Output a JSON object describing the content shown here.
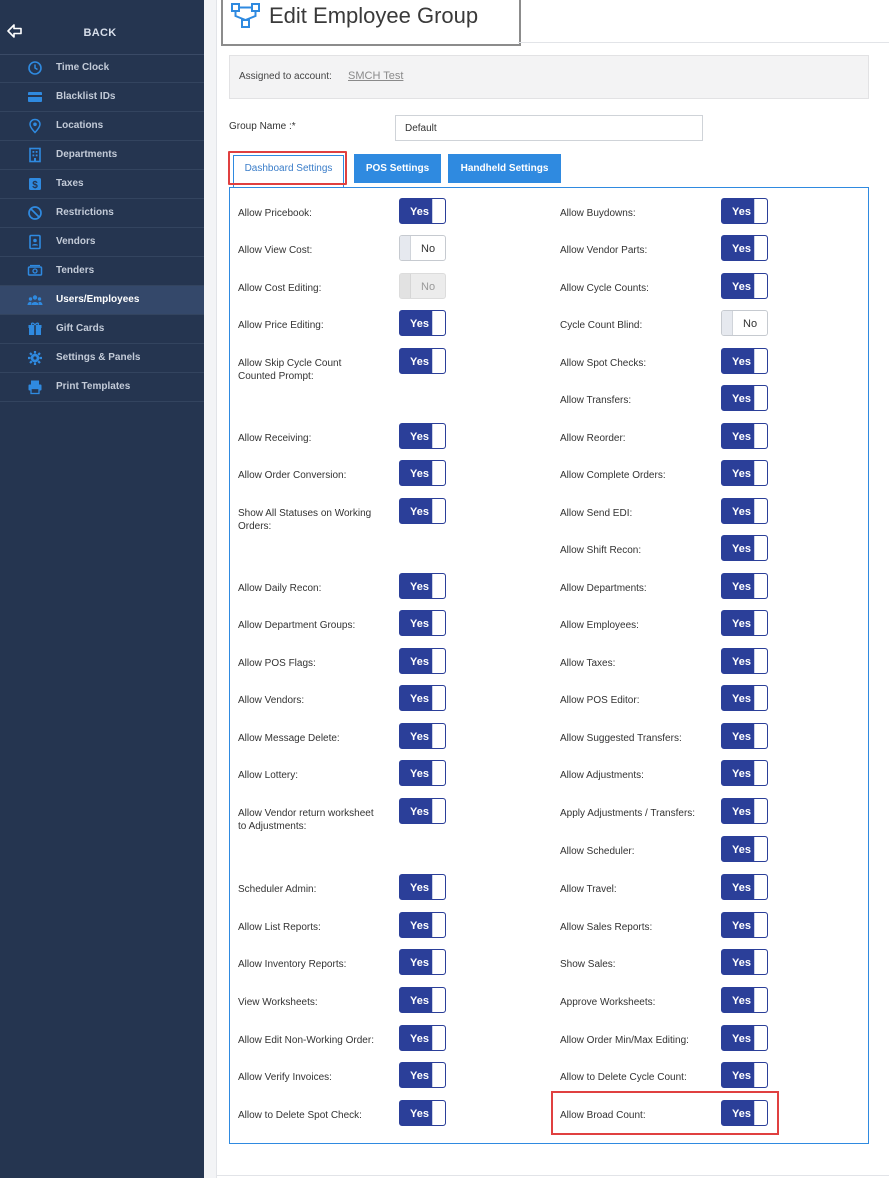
{
  "sidebar": {
    "back_label": "BACK",
    "items": [
      {
        "label": "Time Clock",
        "icon": "clock-icon",
        "active": false
      },
      {
        "label": "Blacklist IDs",
        "icon": "id-card-icon",
        "active": false
      },
      {
        "label": "Locations",
        "icon": "map-pin-icon",
        "active": false
      },
      {
        "label": "Departments",
        "icon": "building-icon",
        "active": false
      },
      {
        "label": "Taxes",
        "icon": "dollar-icon",
        "active": false
      },
      {
        "label": "Restrictions",
        "icon": "ban-icon",
        "active": false
      },
      {
        "label": "Vendors",
        "icon": "contact-book-icon",
        "active": false
      },
      {
        "label": "Tenders",
        "icon": "cash-icon",
        "active": false
      },
      {
        "label": "Users/Employees",
        "icon": "users-icon",
        "active": true
      },
      {
        "label": "Gift Cards",
        "icon": "gift-icon",
        "active": false
      },
      {
        "label": "Settings & Panels",
        "icon": "gear-icon",
        "active": false
      },
      {
        "label": "Print Templates",
        "icon": "printer-icon",
        "active": false
      }
    ]
  },
  "header": {
    "title": "Edit Employee Group",
    "icon": "group-hierarchy-icon"
  },
  "account": {
    "label": "Assigned to account:",
    "value": "SMCH Test"
  },
  "group_name": {
    "label": "Group Name :*",
    "value": "Default"
  },
  "tabs": [
    {
      "label": "Dashboard Settings",
      "active": true
    },
    {
      "label": "POS Settings",
      "active": false
    },
    {
      "label": "Handheld Settings",
      "active": false
    }
  ],
  "colors": {
    "accent": "#2f8ae0",
    "toggle_on": "#2b3f99",
    "sidebar": "#253550",
    "highlight": "#e04040"
  },
  "left_settings": [
    {
      "label": "Allow Pricebook:",
      "state": "Yes"
    },
    {
      "label": "Allow View Cost:",
      "state": "No"
    },
    {
      "label": "Allow Cost Editing:",
      "state": "No",
      "disabled": true
    },
    {
      "label": "Allow Price Editing:",
      "state": "Yes"
    },
    {
      "label": "Allow Skip Cycle Count Counted Prompt:",
      "state": "Yes"
    },
    {
      "label": "Allow Receiving:",
      "state": "Yes"
    },
    {
      "label": "Allow Order Conversion:",
      "state": "Yes"
    },
    {
      "label": "Show All Statuses on Working Orders:",
      "state": "Yes"
    },
    {
      "label": "Allow Daily Recon:",
      "state": "Yes"
    },
    {
      "label": "Allow Department Groups:",
      "state": "Yes"
    },
    {
      "label": "Allow POS Flags:",
      "state": "Yes"
    },
    {
      "label": "Allow Vendors:",
      "state": "Yes"
    },
    {
      "label": "Allow Message Delete:",
      "state": "Yes"
    },
    {
      "label": "Allow Lottery:",
      "state": "Yes"
    },
    {
      "label": "Allow Vendor return worksheet to Adjustments:",
      "state": "Yes"
    },
    {
      "label": "Scheduler Admin:",
      "state": "Yes"
    },
    {
      "label": "Allow List Reports:",
      "state": "Yes"
    },
    {
      "label": "Allow Inventory Reports:",
      "state": "Yes"
    },
    {
      "label": "View Worksheets:",
      "state": "Yes"
    },
    {
      "label": "Allow Edit Non-Working Order:",
      "state": "Yes"
    },
    {
      "label": "Allow Verify Invoices:",
      "state": "Yes"
    },
    {
      "label": "Allow to Delete Spot Check:",
      "state": "Yes"
    }
  ],
  "right_settings": [
    {
      "label": "Allow Buydowns:",
      "state": "Yes"
    },
    {
      "label": "Allow Vendor Parts:",
      "state": "Yes"
    },
    {
      "label": "Allow Cycle Counts:",
      "state": "Yes"
    },
    {
      "label": "Cycle Count Blind:",
      "state": "No"
    },
    {
      "label": "Allow Spot Checks:",
      "state": "Yes"
    },
    {
      "label": "Allow Transfers:",
      "state": "Yes"
    },
    {
      "label": "Allow Reorder:",
      "state": "Yes"
    },
    {
      "label": "Allow Complete Orders:",
      "state": "Yes"
    },
    {
      "label": "Allow Send EDI:",
      "state": "Yes"
    },
    {
      "label": "Allow Shift Recon:",
      "state": "Yes"
    },
    {
      "label": "Allow Departments:",
      "state": "Yes"
    },
    {
      "label": "Allow Employees:",
      "state": "Yes"
    },
    {
      "label": "Allow Taxes:",
      "state": "Yes"
    },
    {
      "label": "Allow POS Editor:",
      "state": "Yes"
    },
    {
      "label": "Allow Suggested Transfers:",
      "state": "Yes"
    },
    {
      "label": "Allow Adjustments:",
      "state": "Yes"
    },
    {
      "label": "Apply Adjustments / Transfers:",
      "state": "Yes"
    },
    {
      "label": "Allow Scheduler:",
      "state": "Yes"
    },
    {
      "label": "Allow Travel:",
      "state": "Yes"
    },
    {
      "label": "Allow Sales Reports:",
      "state": "Yes"
    },
    {
      "label": "Show Sales:",
      "state": "Yes"
    },
    {
      "label": "Approve Worksheets:",
      "state": "Yes"
    },
    {
      "label": "Allow Order Min/Max Editing:",
      "state": "Yes"
    },
    {
      "label": "Allow to Delete Cycle Count:",
      "state": "Yes"
    },
    {
      "label": "Allow Broad Count:",
      "state": "Yes"
    }
  ]
}
